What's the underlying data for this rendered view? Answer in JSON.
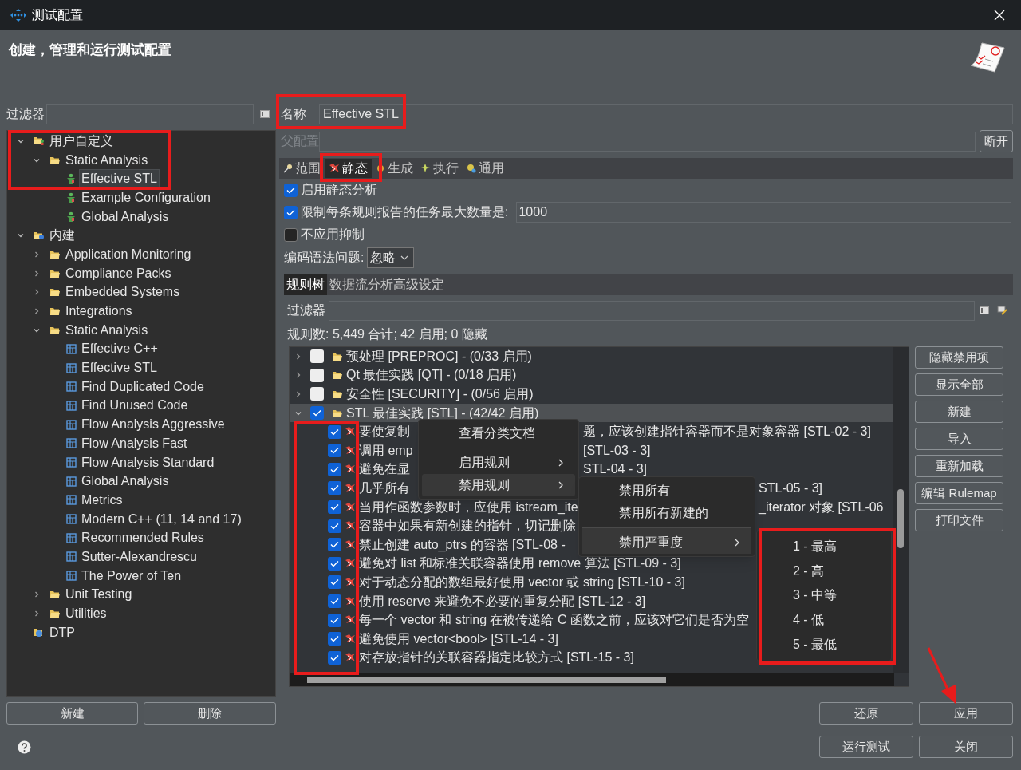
{
  "window": {
    "title": "测试配置"
  },
  "header": {
    "title": "创建，管理和运行测试配置"
  },
  "left": {
    "filter_label": "过滤器",
    "tree": [
      {
        "label": "用户自定义",
        "kind": "user_folder",
        "expanded": true,
        "selected": false,
        "children": [
          {
            "label": "Static Analysis",
            "kind": "folder",
            "expanded": true,
            "selected": false,
            "children": [
              {
                "label": "Effective STL",
                "kind": "user_config",
                "selected": true
              },
              {
                "label": "Example Configuration",
                "kind": "user_config",
                "selected": false
              },
              {
                "label": "Global Analysis",
                "kind": "user_config",
                "selected": false
              }
            ]
          }
        ]
      },
      {
        "label": "内建",
        "kind": "builtin_folder",
        "expanded": true,
        "selected": false,
        "children": [
          {
            "label": "Application Monitoring",
            "kind": "folder",
            "expanded": false,
            "selected": false
          },
          {
            "label": "Compliance Packs",
            "kind": "folder",
            "expanded": false,
            "selected": false
          },
          {
            "label": "Embedded Systems",
            "kind": "folder",
            "expanded": false,
            "selected": false
          },
          {
            "label": "Integrations",
            "kind": "folder",
            "expanded": false,
            "selected": false
          },
          {
            "label": "Static Analysis",
            "kind": "folder",
            "expanded": true,
            "selected": false,
            "children": [
              {
                "label": "Effective C++",
                "kind": "builtin_config",
                "selected": false
              },
              {
                "label": "Effective STL",
                "kind": "builtin_config",
                "selected": false
              },
              {
                "label": "Find Duplicated Code",
                "kind": "builtin_config",
                "selected": false
              },
              {
                "label": "Find Unused Code",
                "kind": "builtin_config",
                "selected": false
              },
              {
                "label": "Flow Analysis Aggressive",
                "kind": "builtin_config",
                "selected": false
              },
              {
                "label": "Flow Analysis Fast",
                "kind": "builtin_config",
                "selected": false
              },
              {
                "label": "Flow Analysis Standard",
                "kind": "builtin_config",
                "selected": false
              },
              {
                "label": "Global Analysis",
                "kind": "builtin_config",
                "selected": false
              },
              {
                "label": "Metrics",
                "kind": "builtin_config",
                "selected": false
              },
              {
                "label": "Modern C++ (11, 14 and 17)",
                "kind": "builtin_config",
                "selected": false
              },
              {
                "label": "Recommended Rules",
                "kind": "builtin_config",
                "selected": false
              },
              {
                "label": "Sutter-Alexandrescu",
                "kind": "builtin_config",
                "selected": false
              },
              {
                "label": "The Power of Ten",
                "kind": "builtin_config",
                "selected": false
              }
            ]
          },
          {
            "label": "Unit Testing",
            "kind": "folder",
            "expanded": false,
            "selected": false
          },
          {
            "label": "Utilities",
            "kind": "folder",
            "expanded": false,
            "selected": false
          }
        ]
      },
      {
        "label": "DTP",
        "kind": "dtp",
        "selected": false
      }
    ],
    "buttons": [
      "新建",
      "删除"
    ]
  },
  "config": {
    "name_label": "名称",
    "name_value": "Effective STL",
    "parent_label": "父配置",
    "parent_disabled": true,
    "disconnect_button": "断开",
    "tabs": [
      {
        "label": "范围",
        "kind": "scope",
        "selected": false
      },
      {
        "label": "静态",
        "kind": "static",
        "selected": true
      },
      {
        "label": "生成",
        "kind": "generate",
        "selected": false
      },
      {
        "label": "执行",
        "kind": "execute",
        "selected": false
      },
      {
        "label": "通用",
        "kind": "common",
        "selected": false
      }
    ],
    "options": [
      {
        "kind": "checkbox",
        "label": "启用静态分析",
        "checked": true
      },
      {
        "kind": "checkbox_field",
        "label": "限制每条规则报告的任务最大数量是:",
        "checked": true,
        "value": "1000"
      },
      {
        "kind": "checkbox",
        "label": "不应用抑制",
        "checked": false
      },
      {
        "kind": "select",
        "label": "编码语法问题:",
        "value": "忽略"
      }
    ],
    "subtabs": [
      {
        "label": "规则树",
        "selected": true
      },
      {
        "label": "数据流分析高级设定",
        "selected": false
      }
    ],
    "rule_filter_label": "过滤器",
    "rule_count": "规则数: 5,449 合计; 42 启用; 0 隐藏",
    "categories": [
      {
        "label": "预处理 [PREPROC] - (0/33 启用)",
        "checked": false,
        "expanded": false,
        "selected": false
      },
      {
        "label": "Qt 最佳实践 [QT] - (0/18 启用)",
        "checked": false,
        "expanded": false,
        "selected": false
      },
      {
        "label": "安全性 [SECURITY] - (0/56 启用)",
        "checked": false,
        "expanded": false,
        "selected": false
      },
      {
        "label": "STL 最佳实践 [STL] - (42/42 启用)",
        "checked": true,
        "expanded": true,
        "selected": true,
        "rules": [
          {
            "text": "要使复制",
            "tail": "题，应该创建指针容器而不是对象容器 [STL-02 - 3]",
            "checked": true
          },
          {
            "text": "调用 emp",
            "tail": "[STL-03 - 3]",
            "checked": true
          },
          {
            "text": "避免在显",
            "tail": "STL-04 - 3]",
            "checked": true
          },
          {
            "text": "几乎所有",
            "tail": "STL-05 - 3]",
            "checked": true
          },
          {
            "text": "当用作函数参数时，应使用 istream_ite",
            "tail": "_iterator 对象 [STL-06",
            "checked": true
          },
          {
            "text": "容器中如果有新创建的指针，切记删除",
            "checked": true
          },
          {
            "text": "禁止创建 auto_ptrs 的容器 [STL-08 -",
            "checked": true
          },
          {
            "text": "避免对 list 和标准关联容器使用 remove 算法 [STL-09 - 3]",
            "checked": true
          },
          {
            "text": "对于动态分配的数组最好使用 vector 或 string [STL-10 - 3]",
            "checked": true
          },
          {
            "text": "使用 reserve 来避免不必要的重复分配 [STL-12 - 3]",
            "checked": true
          },
          {
            "text": "每一个 vector 和 string 在被传递给 C 函数之前，应该对它们是否为空",
            "checked": true
          },
          {
            "text": "避免使用 vector<bool> [STL-14 - 3]",
            "checked": true
          },
          {
            "text": "对存放指针的关联容器指定比较方式 [STL-15 - 3]",
            "checked": true
          }
        ]
      }
    ],
    "side_buttons": [
      "隐藏禁用项",
      "显示全部",
      "新建",
      "导入",
      "重新加载",
      "编辑 Rulemap",
      "打印文件"
    ]
  },
  "context_menu": [
    {
      "label": "查看分类文档",
      "submenu": false,
      "selected": false,
      "separator_before": false
    },
    {
      "label": "启用规则",
      "submenu": true,
      "selected": false,
      "separator_before": true
    },
    {
      "label": "禁用规则",
      "submenu": true,
      "selected": true,
      "separator_before": false
    }
  ],
  "submenu": [
    {
      "label": "禁用所有",
      "submenu": false,
      "selected": false,
      "separator_before": false
    },
    {
      "label": "禁用所有新建的",
      "submenu": false,
      "selected": false,
      "separator_before": false
    },
    {
      "label": "禁用严重度",
      "submenu": true,
      "selected": true,
      "separator_before": true
    }
  ],
  "severity_menu": [
    "1 - 最高",
    "2 - 高",
    "3 - 中等",
    "4 - 低",
    "5 - 最低"
  ],
  "footer": {
    "buttons": [
      "还原",
      "应用"
    ],
    "buttons_row2": [
      "运行测试",
      "关闭"
    ]
  },
  "annotations": [
    {
      "kind": "box"
    },
    {
      "kind": "box"
    },
    {
      "kind": "box"
    },
    {
      "kind": "box"
    },
    {
      "kind": "box"
    },
    {
      "kind": "arrow"
    }
  ]
}
